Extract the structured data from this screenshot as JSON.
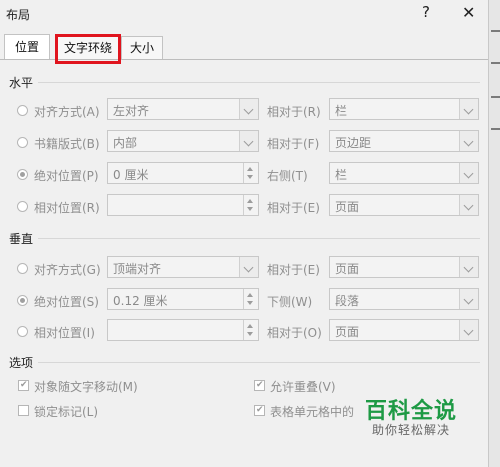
{
  "window": {
    "title": "布局",
    "help_label": "?",
    "close_label": "✕"
  },
  "tabs": [
    {
      "label": "位置"
    },
    {
      "label": "文字环绕"
    },
    {
      "label": "大小"
    }
  ],
  "horizontal": {
    "title": "水平",
    "rows": [
      {
        "label": "对齐方式(A)",
        "value": "左对齐",
        "rel_label": "相对于(R)",
        "rel_value": "栏",
        "selected": false
      },
      {
        "label": "书籍版式(B)",
        "value": "内部",
        "rel_label": "相对于(F)",
        "rel_value": "页边距",
        "selected": false
      },
      {
        "label": "绝对位置(P)",
        "value": "0 厘米",
        "rel_label": "右侧(T)",
        "rel_value": "栏",
        "selected": true
      },
      {
        "label": "相对位置(R)",
        "value": "",
        "rel_label": "相对于(E)",
        "rel_value": "页面",
        "selected": false
      }
    ]
  },
  "vertical": {
    "title": "垂直",
    "rows": [
      {
        "label": "对齐方式(G)",
        "value": "顶端对齐",
        "rel_label": "相对于(E)",
        "rel_value": "页面",
        "selected": false
      },
      {
        "label": "绝对位置(S)",
        "value": "0.12 厘米",
        "rel_label": "下侧(W)",
        "rel_value": "段落",
        "selected": true
      },
      {
        "label": "相对位置(I)",
        "value": "",
        "rel_label": "相对于(O)",
        "rel_value": "页面",
        "selected": false
      }
    ]
  },
  "options": {
    "title": "选项",
    "move_with_text": {
      "label": "对象随文字移动(M)",
      "checked": true
    },
    "lock_anchor": {
      "label": "锁定标记(L)",
      "checked": false
    },
    "allow_overlap": {
      "label": "允许重叠(V)",
      "checked": true
    },
    "in_table_cell": {
      "label": "表格单元格中的",
      "checked": true
    }
  },
  "watermark": {
    "main": "百科全说",
    "sub": "助你轻松解决"
  },
  "colors": {
    "highlight": "#e0141e",
    "watermark": "#1e9a45"
  }
}
